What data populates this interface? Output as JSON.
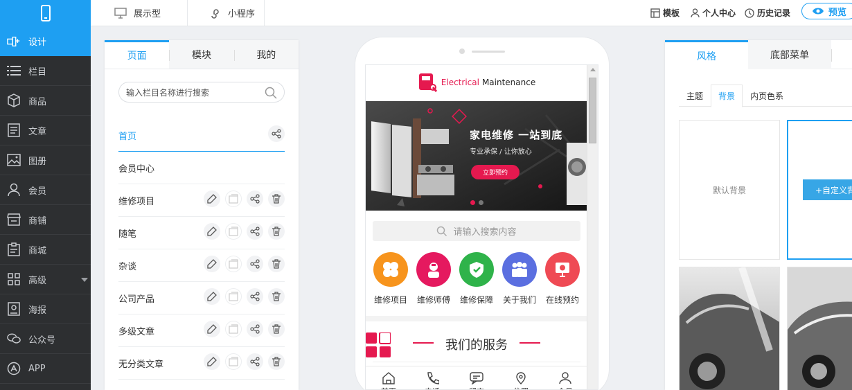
{
  "top_tabs": [
    "展示型",
    "小程序"
  ],
  "top_right": {
    "template": "模板",
    "user_center": "个人中心",
    "history": "历史记录",
    "preview": "预览"
  },
  "sidebar": {
    "items": [
      {
        "label": "设计",
        "icon": "design-icon",
        "active": true
      },
      {
        "label": "栏目",
        "icon": "list-icon"
      },
      {
        "label": "商品",
        "icon": "box-icon"
      },
      {
        "label": "文章",
        "icon": "article-icon"
      },
      {
        "label": "图册",
        "icon": "image-icon"
      },
      {
        "label": "会员",
        "icon": "user-icon"
      },
      {
        "label": "商铺",
        "icon": "shop-icon"
      },
      {
        "label": "商城",
        "icon": "mall-icon"
      },
      {
        "label": "高级",
        "icon": "grid-icon",
        "has_arrow": true
      },
      {
        "label": "海报",
        "icon": "poster-icon"
      },
      {
        "label": "公众号",
        "icon": "wechat-icon"
      },
      {
        "label": "APP",
        "icon": "app-icon"
      }
    ]
  },
  "left_panel": {
    "tabs": [
      "页面",
      "模块",
      "我的"
    ],
    "search_placeholder": "输入栏目名称进行搜索",
    "pages": [
      "首页",
      "会员中心",
      "维修项目",
      "随笔",
      "杂谈",
      "公司产品",
      "多级文章",
      "无分类文章"
    ]
  },
  "phone": {
    "brand_red": "Electrical",
    "brand_black": "Maintenance",
    "banner_headline": "家电维修 一站到底",
    "banner_sub": "专业承保 / 让你放心",
    "banner_button": "立即预约",
    "search_placeholder": "请输入搜索内容",
    "quick_links": [
      {
        "label": "维修项目",
        "color": "#f7941d"
      },
      {
        "label": "维修师傅",
        "color": "#e5195f"
      },
      {
        "label": "维修保障",
        "color": "#2fb34a"
      },
      {
        "label": "关于我们",
        "color": "#5b6fe0"
      },
      {
        "label": "在线预约",
        "color": "#ef4a54"
      }
    ],
    "section_title": "我们的服务",
    "bottom_tabs": [
      "首页",
      "电话",
      "留言",
      "位置",
      "会员"
    ]
  },
  "right_panel": {
    "tabs": [
      "风格",
      "底部菜单"
    ],
    "subtabs": [
      "主题",
      "背景",
      "内页色系"
    ],
    "default_bg": "默认背景",
    "custom_bg": "+自定义背景"
  },
  "colors": {
    "accent": "#1e9ff2",
    "brand_red": "#e5194f",
    "sidebar_bg": "#2d2f31"
  }
}
